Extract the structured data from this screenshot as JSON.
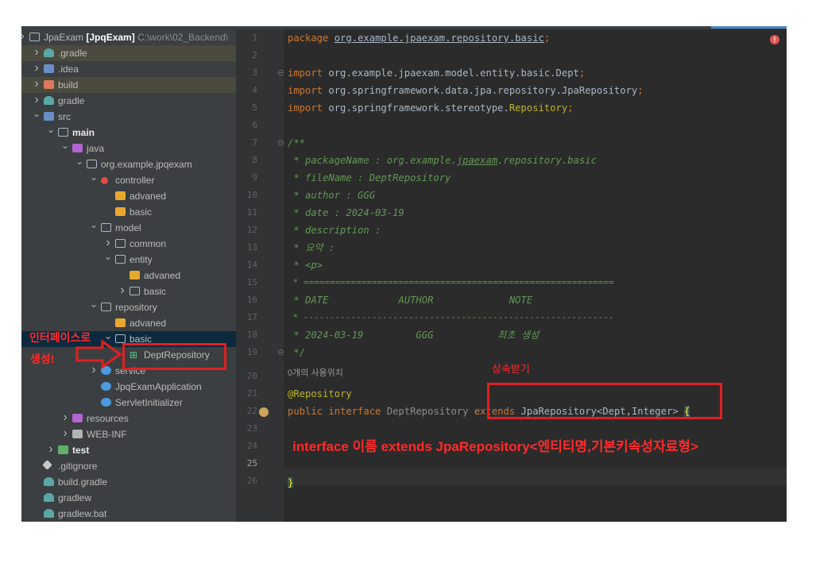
{
  "tree": [
    {
      "arrow": "collapsed",
      "depth": 0,
      "icon": "pkg",
      "label": "JpaExam",
      "bold": "[JpqExam]",
      "path": "C:\\work\\02_Backend\\"
    },
    {
      "arrow": "collapsed",
      "depth": 1,
      "icon": "grad",
      "label": ".gradle",
      "highlight": true
    },
    {
      "arrow": "collapsed",
      "depth": 1,
      "icon": "src",
      "label": ".idea"
    },
    {
      "arrow": "collapsed",
      "depth": 1,
      "icon": "build",
      "label": "build",
      "highlight": true
    },
    {
      "arrow": "collapsed",
      "depth": 1,
      "icon": "grad",
      "label": "gradle"
    },
    {
      "arrow": "expanded",
      "depth": 1,
      "icon": "src",
      "label": "src"
    },
    {
      "arrow": "expanded",
      "depth": 2,
      "icon": "pkg",
      "label": "main",
      "strong": true
    },
    {
      "arrow": "expanded",
      "depth": 3,
      "icon": "res",
      "label": "java"
    },
    {
      "arrow": "expanded",
      "depth": 4,
      "icon": "pkg",
      "label": "org.example.jpqexam"
    },
    {
      "arrow": "expanded",
      "depth": 5,
      "icon": "gear",
      "label": "controller"
    },
    {
      "arrow": "",
      "depth": 6,
      "icon": "folder",
      "label": "advaned"
    },
    {
      "arrow": "",
      "depth": 6,
      "icon": "folder",
      "label": "basic"
    },
    {
      "arrow": "expanded",
      "depth": 5,
      "icon": "pkg",
      "label": "model"
    },
    {
      "arrow": "collapsed",
      "depth": 6,
      "icon": "pkg",
      "label": "common"
    },
    {
      "arrow": "expanded",
      "depth": 6,
      "icon": "pkg",
      "label": "entity"
    },
    {
      "arrow": "",
      "depth": 7,
      "icon": "folder",
      "label": "advaned"
    },
    {
      "arrow": "collapsed",
      "depth": 7,
      "icon": "pkg",
      "label": "basic"
    },
    {
      "arrow": "expanded",
      "depth": 5,
      "icon": "pkg",
      "label": "repository"
    },
    {
      "arrow": "",
      "depth": 6,
      "icon": "folder",
      "label": "advaned"
    },
    {
      "arrow": "expanded",
      "depth": 6,
      "icon": "pkg",
      "label": "basic",
      "selected": true
    },
    {
      "arrow": "",
      "depth": 7,
      "icon": "intf",
      "label": "DeptRepository"
    },
    {
      "arrow": "collapsed",
      "depth": 5,
      "icon": "java",
      "label": "service"
    },
    {
      "arrow": "",
      "depth": 5,
      "icon": "java",
      "label": "JpqExamApplication"
    },
    {
      "arrow": "",
      "depth": 5,
      "icon": "java",
      "label": "ServletInitializer"
    },
    {
      "arrow": "collapsed",
      "depth": 3,
      "icon": "res",
      "label": "resources"
    },
    {
      "arrow": "collapsed",
      "depth": 3,
      "icon": "grey",
      "label": "WEB-INF"
    },
    {
      "arrow": "collapsed",
      "depth": 2,
      "icon": "test",
      "label": "test",
      "strong": true
    },
    {
      "arrow": "",
      "depth": 1,
      "icon": "git",
      "label": ".gitignore"
    },
    {
      "arrow": "",
      "depth": 1,
      "icon": "grad",
      "label": "build.gradle"
    },
    {
      "arrow": "",
      "depth": 1,
      "icon": "grad",
      "label": "gradlew"
    },
    {
      "arrow": "",
      "depth": 1,
      "icon": "grad",
      "label": "gradlew.bat"
    }
  ],
  "editor": {
    "line_numbers": [
      "1",
      "2",
      "3",
      "4",
      "5",
      "6",
      "7",
      "8",
      "9",
      "10",
      "11",
      "12",
      "13",
      "14",
      "15",
      "16",
      "17",
      "18",
      "19",
      "20",
      "21",
      "22",
      "23",
      "24",
      "25",
      "26"
    ],
    "current_line": "25",
    "usage_hint": "0개의 사용위치",
    "code": {
      "l1_kw": "package",
      "l1_pkg": "org.example.jpaexam.repository.basic",
      "l1_end": ";",
      "l3_kw": "import",
      "l3_rest": "org.example.jpaexam.model.entity.basic.Dept",
      "l4_kw": "import",
      "l4_rest": "org.springframework.data.jpa.repository.JpaRepository",
      "l5_kw": "import",
      "l5_rest": "org.springframework.stereotype.",
      "l5_cls": "Repository",
      "semi": ";",
      "l7": "/**",
      "l8a": " * packageName : org.example.",
      "l8b": "jpaexam",
      "l8c": ".repository.basic",
      "l9": " * fileName : DeptRepository",
      "l10": " * author : GGG",
      "l11": " * date : 2024-03-19",
      "l12": " * description :",
      "l13": " * 요약 :",
      "l14": " * <p>",
      "l15": " * ===========================================================",
      "l16": " * DATE            AUTHOR             NOTE",
      "l17": " * -----------------------------------------------------------",
      "l18": " * 2024-03-19         GGG           최초 생성",
      "l19": " */",
      "l20": "@Repository",
      "l21_kw": "public interface",
      "l21_name": "DeptRepository",
      "l21_ext": "extends",
      "l21_type": "JpaRepository<Dept,Integer>",
      "l21_brace": "{",
      "l25": "}"
    }
  },
  "annotations": {
    "interface_note_1": "인터페이스로",
    "interface_note_2": "생성!",
    "inherit_note": "상속받기",
    "syntax_note": "interface 이름 extends JpaRepository<엔티티명,기본키속성자료형>"
  },
  "colors": {
    "annotation_red": "#ff2a2a",
    "keyword": "#cc7832",
    "comment": "#629755",
    "annotation": "#bbb529"
  }
}
